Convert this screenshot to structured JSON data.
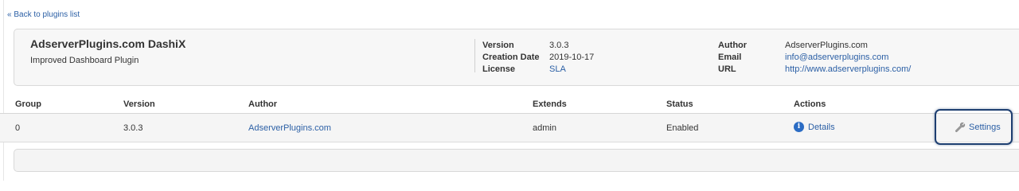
{
  "nav": {
    "back_label": "« Back to plugins list"
  },
  "plugin": {
    "name": "AdserverPlugins.com DashiX",
    "description": "Improved Dashboard Plugin",
    "meta": {
      "version_label": "Version",
      "version_value": "3.0.3",
      "creation_date_label": "Creation Date",
      "creation_date_value": "2019-10-17",
      "license_label": "License",
      "license_value": "SLA",
      "author_label": "Author",
      "author_value": "AdserverPlugins.com",
      "email_label": "Email",
      "email_value": "info@adserverplugins.com",
      "url_label": "URL",
      "url_value": "http://www.adserverplugins.com/"
    }
  },
  "table": {
    "headers": [
      "Group",
      "Version",
      "Author",
      "Extends",
      "Status",
      "Actions"
    ],
    "rows": [
      {
        "group": "0",
        "version": "3.0.3",
        "author": "AdserverPlugins.com",
        "extends": "admin",
        "status": "Enabled",
        "details_label": "Details",
        "settings_label": "Settings"
      }
    ]
  },
  "icons": {
    "details": "info-icon",
    "settings": "wrench-icon"
  },
  "colors": {
    "link": "#2b5fa5",
    "focus_outline": "#1d3e70",
    "info_icon": "#2b6cc4"
  }
}
